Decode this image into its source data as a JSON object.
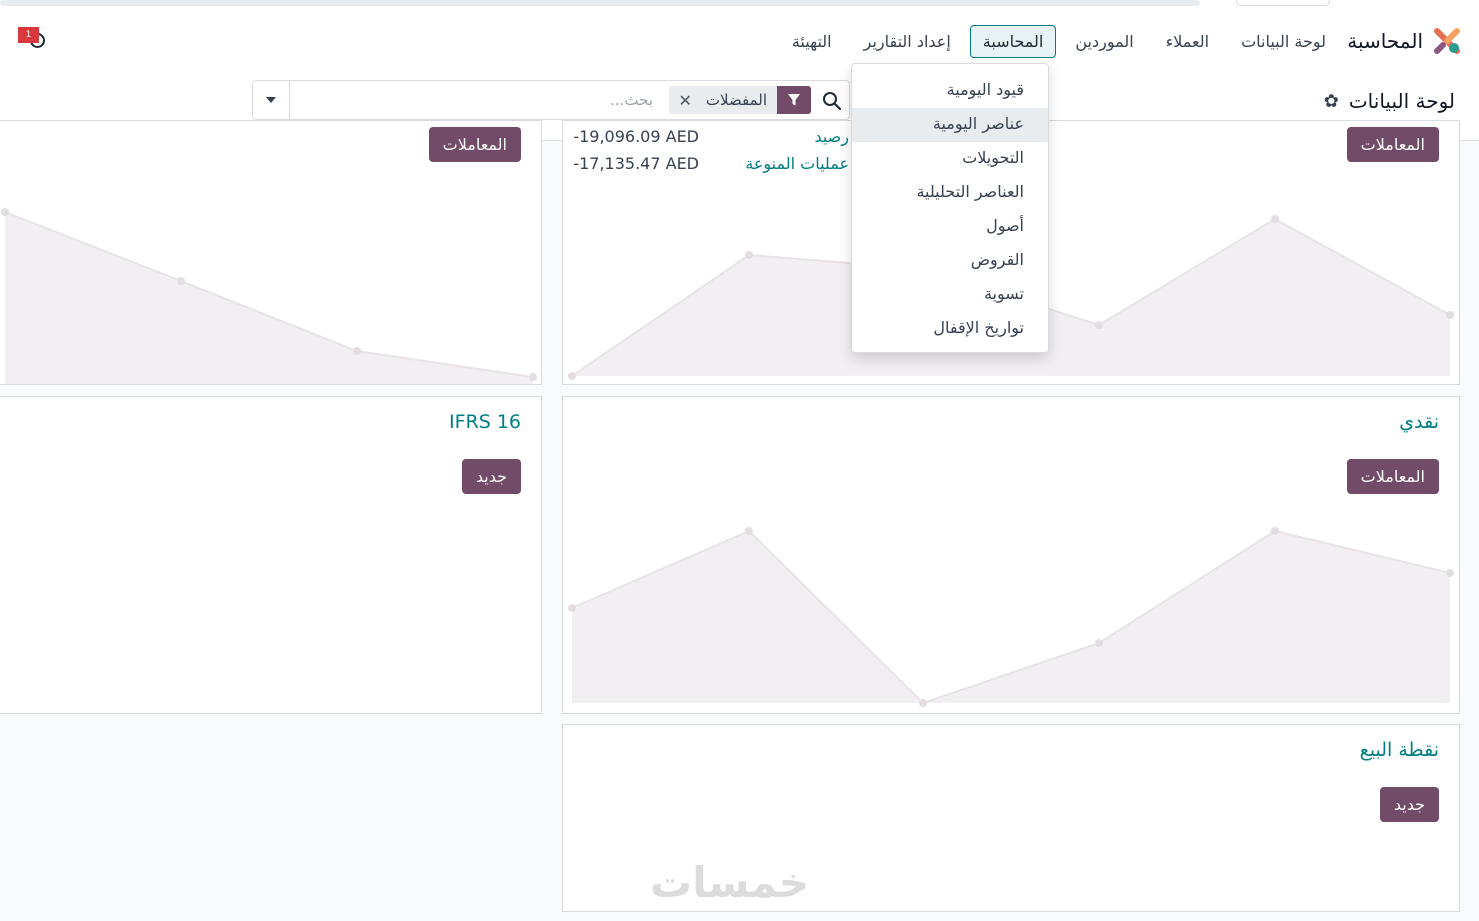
{
  "navbar": {
    "app_name": "المحاسبة",
    "menu": [
      "لوحة البيانات",
      "العملاء",
      "الموردين",
      "المحاسبة",
      "إعداد التقارير",
      "التهيئة"
    ],
    "activity_badge": "1"
  },
  "control_panel": {
    "title": "لوحة البيانات",
    "search": {
      "placeholder": "بحث...",
      "facet": "المفضلات"
    }
  },
  "accounting_dropdown": {
    "items": [
      "قيود اليومية",
      "عناصر اليومية",
      "التحويلات",
      "العناصر التحليلية",
      "أصول",
      "القروض",
      "تسوية",
      "تواريخ الإقفال"
    ],
    "highlighted_index": 1
  },
  "cards": {
    "top_right": {
      "button": "المعاملات",
      "stats": [
        {
          "label": "رصيد",
          "value": "-19,096.09 AED"
        },
        {
          "label": "عمليات المنوعة",
          "value": "-17,135.47 AED"
        }
      ]
    },
    "top_left": {
      "button": "المعاملات"
    },
    "cash": {
      "title": "نقدي",
      "button": "المعاملات"
    },
    "ifrs": {
      "title": "IFRS 16",
      "button": "جديد"
    },
    "pos": {
      "title": "نقطة البيع",
      "button": "جديد"
    }
  },
  "watermark": "خمسات",
  "colors": {
    "brand_purple": "#714b67",
    "teal": "#017e84",
    "badge_red": "#d9383c"
  }
}
